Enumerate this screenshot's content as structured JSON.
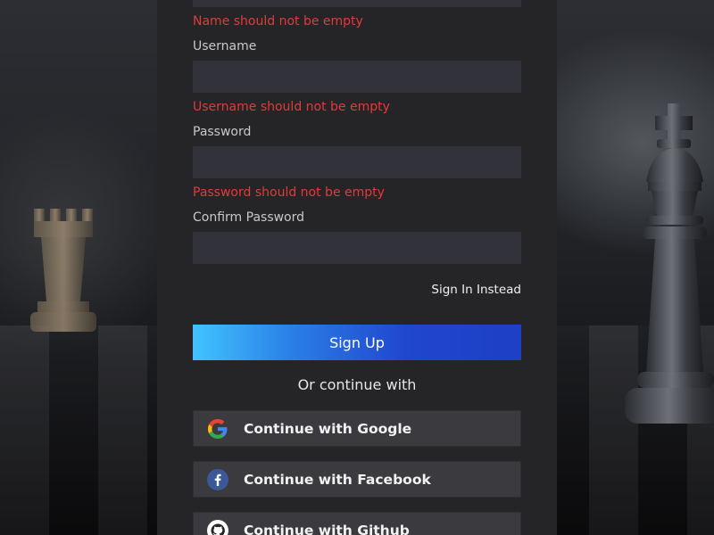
{
  "form": {
    "name_error": "Name should not be empty",
    "username_label": "Username",
    "username_value": "",
    "username_error": "Username should not be empty",
    "password_label": "Password",
    "password_value": "",
    "password_error": "Password should not be empty",
    "confirm_password_label": "Confirm Password",
    "confirm_password_value": "",
    "sign_in_link": "Sign In Instead",
    "sign_up_button": "Sign Up",
    "or_continue_with": "Or continue with"
  },
  "social": [
    {
      "label": "Continue with Google",
      "icon": "google-icon"
    },
    {
      "label": "Continue with Facebook",
      "icon": "facebook-icon"
    },
    {
      "label": "Continue with Github",
      "icon": "github-icon"
    }
  ],
  "colors": {
    "error": "#e23a3a",
    "panel_bg": "#252527",
    "input_bg": "#32333a",
    "button_gradient_start": "#41c3ff",
    "button_gradient_end": "#1d3fc4",
    "social_bg": "#3a3a3f",
    "facebook_blue": "#3b5998"
  }
}
